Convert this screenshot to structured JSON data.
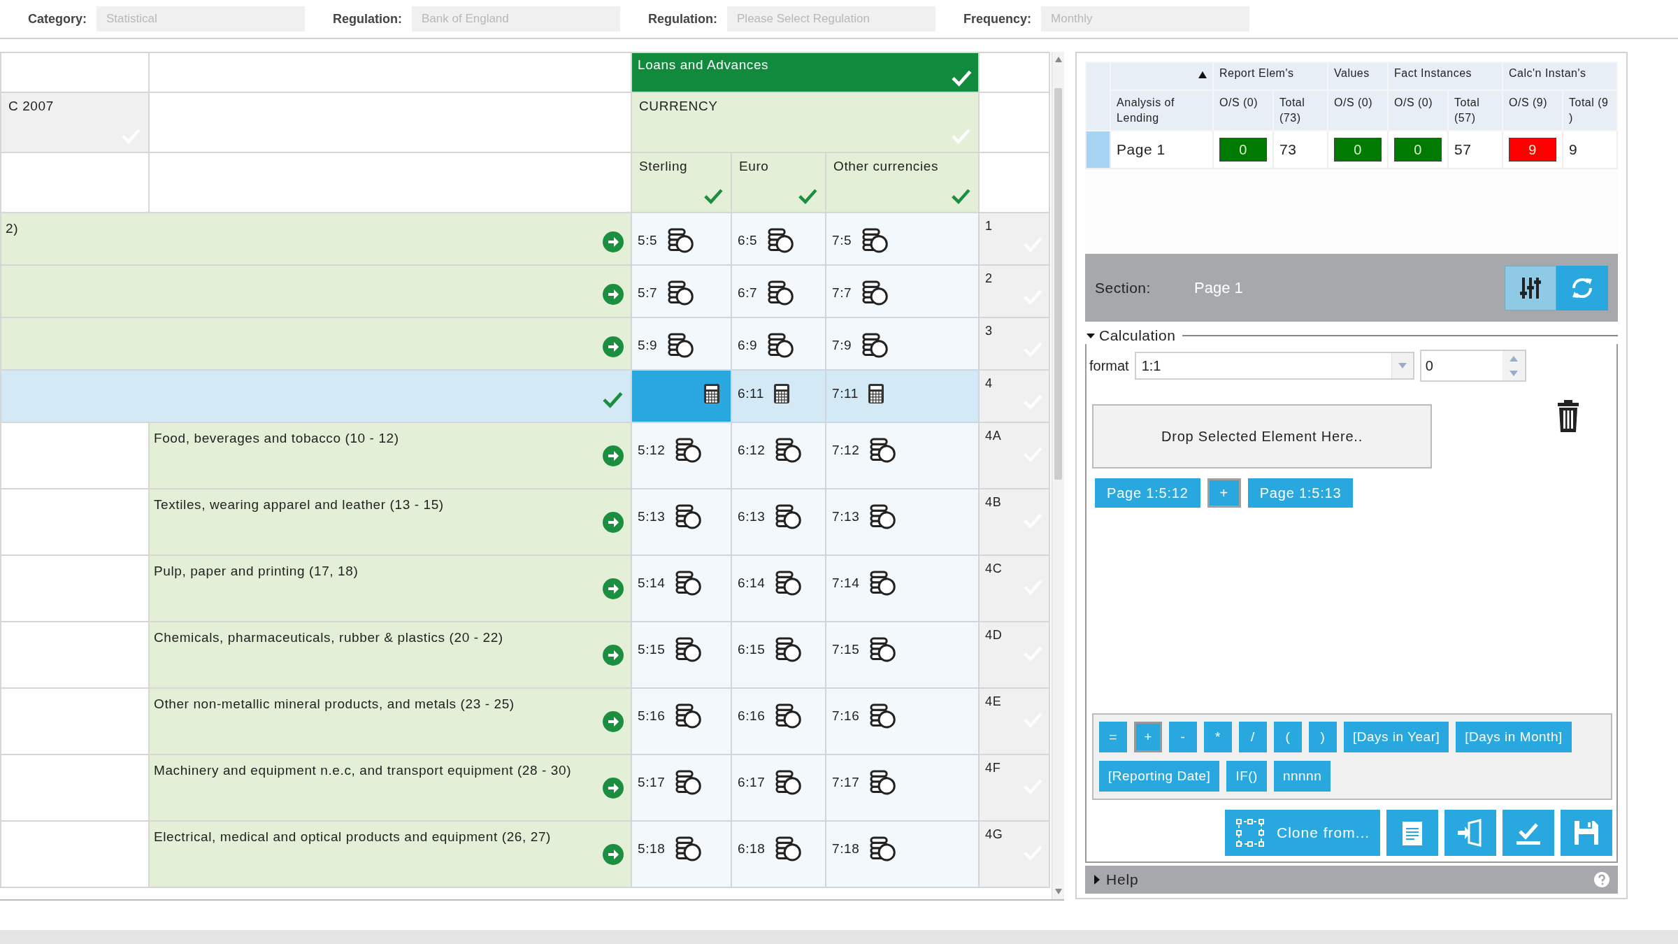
{
  "filters": [
    {
      "label": "Category:",
      "value": "Statistical"
    },
    {
      "label": "Regulation:",
      "value": "Bank of England"
    },
    {
      "label": "Regulation:",
      "value": "Please Select Regulation"
    },
    {
      "label": "Frequency:",
      "value": "Monthly"
    }
  ],
  "grid": {
    "group": "Loans and Advances",
    "dimension": "CURRENCY",
    "row_header": "C 2007",
    "columns": [
      "Sterling",
      "Euro",
      "Other currencies"
    ],
    "rows": [
      {
        "kind": "merged",
        "label": "2)",
        "selected": false,
        "number": "1",
        "cells": [
          {
            "kind": "coins",
            "label": "5:5",
            "selected": false
          },
          {
            "kind": "coins",
            "label": "6:5",
            "selected": false
          },
          {
            "kind": "coins",
            "label": "7:5",
            "selected": false
          }
        ]
      },
      {
        "kind": "merged",
        "selected": false,
        "number": "2",
        "cells": [
          {
            "kind": "coins",
            "label": "5:7",
            "selected": false
          },
          {
            "kind": "coins",
            "label": "6:7",
            "selected": false
          },
          {
            "kind": "coins",
            "label": "7:7",
            "selected": false
          }
        ]
      },
      {
        "kind": "merged",
        "selected": false,
        "number": "3",
        "cells": [
          {
            "kind": "coins",
            "label": "5:9",
            "selected": false
          },
          {
            "kind": "coins",
            "label": "6:9",
            "selected": false
          },
          {
            "kind": "coins",
            "label": "7:9",
            "selected": false
          }
        ]
      },
      {
        "kind": "merged",
        "selected": true,
        "number": "4",
        "cells": [
          {
            "kind": "calculator",
            "selected": true
          },
          {
            "kind": "calculator",
            "label": "6:11",
            "selected": false
          },
          {
            "kind": "calculator",
            "label": "7:11",
            "selected": false
          }
        ]
      },
      {
        "kind": "split",
        "label": "Food, beverages and tobacco (10 - 12)",
        "selected": false,
        "number": "4A",
        "cells": [
          {
            "kind": "coins",
            "label": "5:12",
            "selected": false
          },
          {
            "kind": "coins",
            "label": "6:12",
            "selected": false
          },
          {
            "kind": "coins",
            "label": "7:12",
            "selected": false
          }
        ]
      },
      {
        "kind": "split",
        "label": "Textiles, wearing apparel and leather (13 - 15)",
        "selected": false,
        "number": "4B",
        "cells": [
          {
            "kind": "coins",
            "label": "5:13",
            "selected": false
          },
          {
            "kind": "coins",
            "label": "6:13",
            "selected": false
          },
          {
            "kind": "coins",
            "label": "7:13",
            "selected": false
          }
        ]
      },
      {
        "kind": "split",
        "label": "Pulp, paper and printing (17, 18)",
        "selected": false,
        "number": "4C",
        "cells": [
          {
            "kind": "coins",
            "label": "5:14",
            "selected": false
          },
          {
            "kind": "coins",
            "label": "6:14",
            "selected": false
          },
          {
            "kind": "coins",
            "label": "7:14",
            "selected": false
          }
        ]
      },
      {
        "kind": "split",
        "label": "Chemicals, pharmaceuticals, rubber & plastics (20 - 22)",
        "selected": false,
        "number": "4D",
        "cells": [
          {
            "kind": "coins",
            "label": "5:15",
            "selected": false
          },
          {
            "kind": "coins",
            "label": "6:15",
            "selected": false
          },
          {
            "kind": "coins",
            "label": "7:15",
            "selected": false
          }
        ]
      },
      {
        "kind": "split",
        "label": "Other non-metallic mineral products, and metals (23 - 25)",
        "selected": false,
        "number": "4E",
        "cells": [
          {
            "kind": "coins",
            "label": "5:16",
            "selected": false
          },
          {
            "kind": "coins",
            "label": "6:16",
            "selected": false
          },
          {
            "kind": "coins",
            "label": "7:16",
            "selected": false
          }
        ]
      },
      {
        "kind": "split",
        "label": "Machinery and equipment n.e.c, and transport equipment (28 - 30)",
        "selected": false,
        "number": "4F",
        "cells": [
          {
            "kind": "coins",
            "label": "5:17",
            "selected": false
          },
          {
            "kind": "coins",
            "label": "6:17",
            "selected": false
          },
          {
            "kind": "coins",
            "label": "7:17",
            "selected": false
          }
        ]
      },
      {
        "kind": "split",
        "label": "Electrical, medical and optical products and equipment (26, 27)",
        "selected": false,
        "number": "4G",
        "cells": [
          {
            "kind": "coins",
            "label": "5:18",
            "selected": false
          },
          {
            "kind": "coins",
            "label": "6:18",
            "selected": false
          },
          {
            "kind": "coins",
            "label": "7:18",
            "selected": false
          }
        ]
      }
    ]
  },
  "summary": {
    "first_column": "Analysis of Lending",
    "groups": [
      {
        "label": "Report Elem's",
        "columns": [
          "O/S (0)",
          "Total (73)"
        ]
      },
      {
        "label": "Values",
        "columns": [
          "O/S (0)"
        ]
      },
      {
        "label": "Fact Instances",
        "columns": [
          "O/S (0)",
          "Total (57)"
        ]
      },
      {
        "label": "Calc'n Instan's",
        "columns": [
          "O/S (9)",
          "Total (9 )"
        ]
      }
    ],
    "rows": [
      {
        "label": "Page 1",
        "selected": true,
        "values": [
          {
            "text": "0",
            "color": "#007a00"
          },
          {
            "text": "73"
          },
          {
            "text": "0",
            "color": "#007a00"
          },
          {
            "text": "0",
            "color": "#007a00"
          },
          {
            "text": "57"
          },
          {
            "text": "9",
            "color": "#ff0000"
          },
          {
            "text": "9"
          }
        ]
      }
    ]
  },
  "section": {
    "label": "Section:",
    "value": "Page 1"
  },
  "calculation": {
    "title": "Calculation",
    "expanded": true,
    "format_label": "format",
    "format_value": "1:1",
    "spinner_value": "0",
    "drop_zone": "Drop Selected Element Here..",
    "tokens": [
      {
        "kind": "element",
        "text": "Page 1:5:12",
        "selected": false
      },
      {
        "kind": "operator",
        "text": "+",
        "selected": true
      },
      {
        "kind": "element",
        "text": "Page 1:5:13",
        "selected": false
      }
    ],
    "operators": [
      {
        "text": "=",
        "hovered": false
      },
      {
        "text": "+",
        "hovered": true
      },
      {
        "text": "-",
        "hovered": false
      },
      {
        "text": "*",
        "hovered": false
      },
      {
        "text": "/",
        "hovered": false
      },
      {
        "text": "(",
        "hovered": false
      },
      {
        "text": ")",
        "hovered": false
      },
      {
        "text": "[Days in Year]",
        "hovered": false
      },
      {
        "text": "[Days in Month]",
        "hovered": false
      },
      {
        "text": "[Reporting Date]",
        "hovered": false
      },
      {
        "text": "IF()",
        "hovered": false
      },
      {
        "text": "nnnnn",
        "hovered": false
      }
    ],
    "actions": [
      {
        "kind": "clone",
        "label": "Clone from..."
      },
      {
        "kind": "document"
      },
      {
        "kind": "import"
      },
      {
        "kind": "validate"
      },
      {
        "kind": "save"
      }
    ]
  },
  "help": {
    "title": "Help",
    "expanded": false
  }
}
